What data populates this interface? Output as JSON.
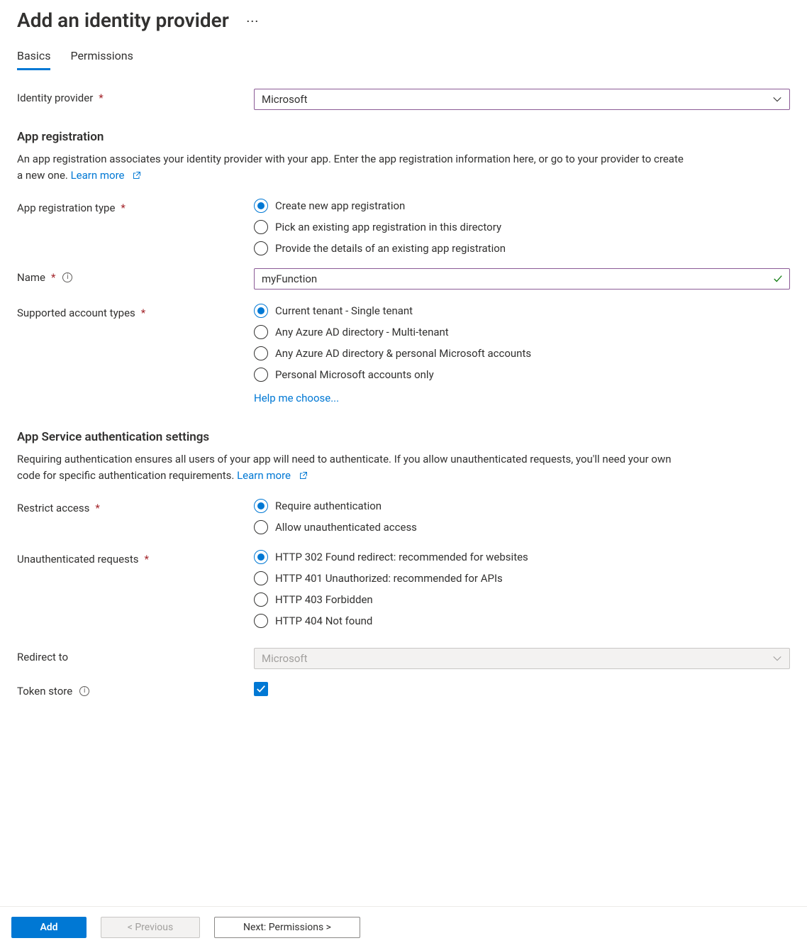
{
  "title": "Add an identity provider",
  "tabs": {
    "basics": "Basics",
    "permissions": "Permissions"
  },
  "identityProvider": {
    "label": "Identity provider",
    "value": "Microsoft"
  },
  "appRegistration": {
    "heading": "App registration",
    "desc": "An app registration associates your identity provider with your app. Enter the app registration information here, or go to your provider to create a new one. ",
    "learnMore": "Learn more",
    "typeLabel": "App registration type",
    "typeOptions": [
      "Create new app registration",
      "Pick an existing app registration in this directory",
      "Provide the details of an existing app registration"
    ],
    "nameLabel": "Name",
    "nameValue": "myFunction",
    "accountTypesLabel": "Supported account types",
    "accountTypes": [
      "Current tenant - Single tenant",
      "Any Azure AD directory - Multi-tenant",
      "Any Azure AD directory & personal Microsoft accounts",
      "Personal Microsoft accounts only"
    ],
    "helpMeChoose": "Help me choose..."
  },
  "authSettings": {
    "heading": "App Service authentication settings",
    "desc": "Requiring authentication ensures all users of your app will need to authenticate. If you allow unauthenticated requests, you'll need your own code for specific authentication requirements. ",
    "learnMore": "Learn more",
    "restrictLabel": "Restrict access",
    "restrictOptions": [
      "Require authentication",
      "Allow unauthenticated access"
    ],
    "unauthLabel": "Unauthenticated requests",
    "unauthOptions": [
      "HTTP 302 Found redirect: recommended for websites",
      "HTTP 401 Unauthorized: recommended for APIs",
      "HTTP 403 Forbidden",
      "HTTP 404 Not found"
    ],
    "redirectToLabel": "Redirect to",
    "redirectToValue": "Microsoft",
    "tokenStoreLabel": "Token store"
  },
  "footer": {
    "add": "Add",
    "previous": "< Previous",
    "next": "Next: Permissions >"
  }
}
